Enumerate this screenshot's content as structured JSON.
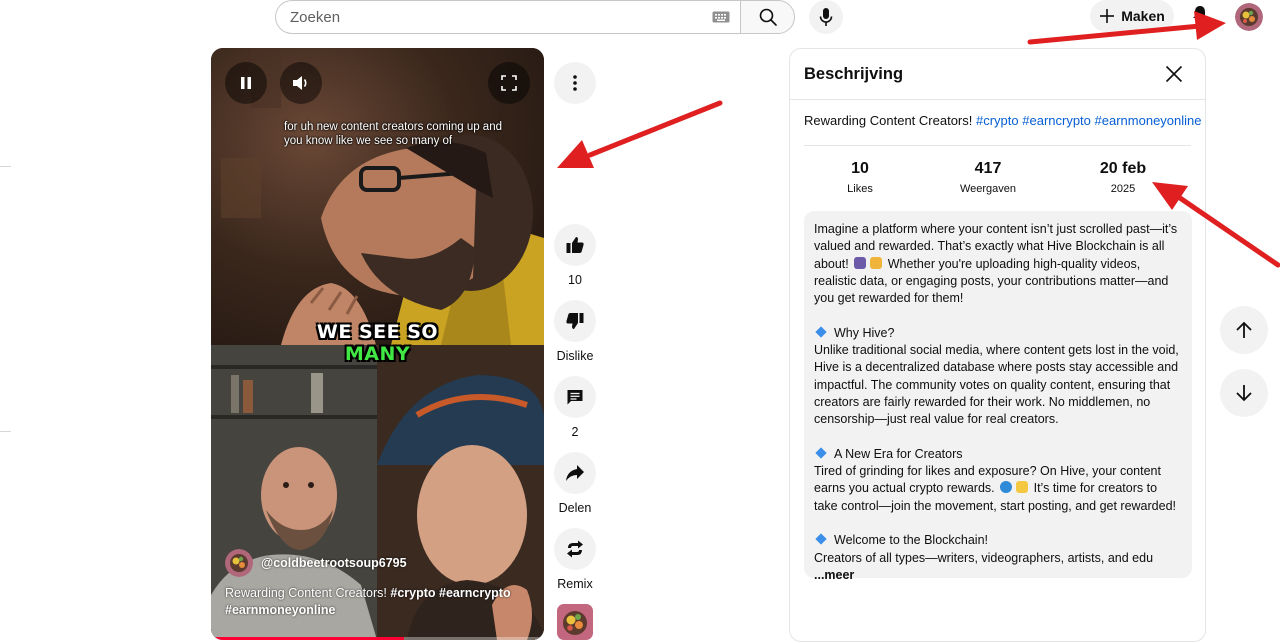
{
  "search": {
    "placeholder": "Zoeken"
  },
  "header": {
    "create_label": "Maken"
  },
  "video": {
    "caption": "for uh new content creators coming up and you know like we see so many of",
    "big_caption_top": "WE SEE SO",
    "big_caption_bottom": "MANY",
    "channel": "@coldbeetrootsoup6795",
    "title_text": "Rewarding Content Creators!",
    "title_tags": [
      "#crypto",
      "#earncrypto",
      "#earnmoneyonline"
    ],
    "progress": 0.58
  },
  "actions": {
    "like_count": "10",
    "dislike_label": "Dislike",
    "comment_count": "2",
    "share_label": "Delen",
    "remix_label": "Remix"
  },
  "description": {
    "panel_title": "Beschrijving",
    "title_text": "Rewarding Content Creators!",
    "tags": [
      "#crypto",
      "#earncrypto",
      "#earnmoneyonline"
    ],
    "stats": [
      {
        "value": "10",
        "label": "Likes"
      },
      {
        "value": "417",
        "label": "Weergaven"
      },
      {
        "value": "20 feb",
        "label": "2025"
      }
    ],
    "para1": "Imagine a platform where your content isn’t just scrolled past—it’s valued and rewarded. That’s exactly what Hive Blockchain is all about!",
    "para1b": "Whether you're uploading high-quality videos, realistic data, or engaging posts, your contributions matter—and you get rewarded for them!",
    "h1": "Why Hive?",
    "para2": "Unlike traditional social media, where content gets lost in the void, Hive is a decentralized database where posts stay accessible and impactful. The community votes on quality content, ensuring that creators are fairly rewarded for their work. No middlemen, no censorship—just real value for real creators.",
    "h2": "A New Era for Creators",
    "para3a": "Tired of grinding for likes and exposure? On Hive, your content earns you actual crypto rewards.",
    "para3b": "It’s time for creators to take control—join the movement, start posting, and get rewarded!",
    "h3": "Welcome to the Blockchain!",
    "para4": "Creators of all types—writers, videographers, artists, and edu",
    "more_label": "...meer"
  },
  "colors": {
    "accent_link": "#065fd4",
    "arrow": "#e02020",
    "progress": "#ff0033",
    "caption_green": "#41e843"
  }
}
